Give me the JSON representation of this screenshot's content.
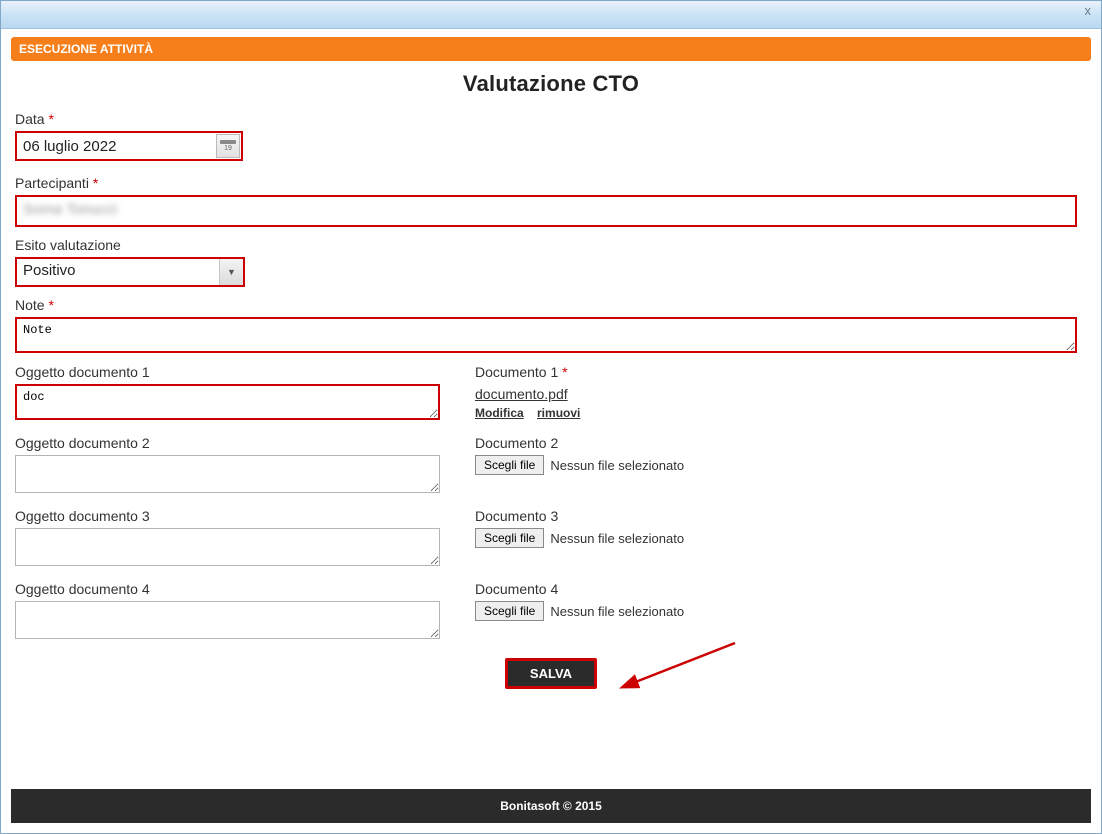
{
  "titlebar": {
    "close": "x"
  },
  "header": {
    "bar_label": "ESECUZIONE ATTIVITÀ",
    "title": "Valutazione CTO"
  },
  "labels": {
    "data": "Data",
    "partecipanti": "Partecipanti",
    "esito": "Esito valutazione",
    "note": "Note",
    "obj1": "Oggetto documento 1",
    "obj2": "Oggetto documento 2",
    "obj3": "Oggetto documento 3",
    "obj4": "Oggetto documento 4",
    "doc1": "Documento 1",
    "doc2": "Documento 2",
    "doc3": "Documento 3",
    "doc4": "Documento 4",
    "required": "*"
  },
  "values": {
    "data": "06 luglio 2022",
    "partecipanti": "Soma Tonucci",
    "esito": "Positivo",
    "note": "Note",
    "obj1": "doc",
    "obj2": "",
    "obj3": "",
    "obj4": "",
    "doc1_filename": "documento.pdf"
  },
  "doc_actions": {
    "edit": "Modifica",
    "remove": "rimuovi"
  },
  "file": {
    "choose": "Scegli file",
    "none": "Nessun file selezionato"
  },
  "calendar": {
    "day": "19"
  },
  "buttons": {
    "save": "SALVA"
  },
  "footer": {
    "text": "Bonitasoft © 2015"
  }
}
